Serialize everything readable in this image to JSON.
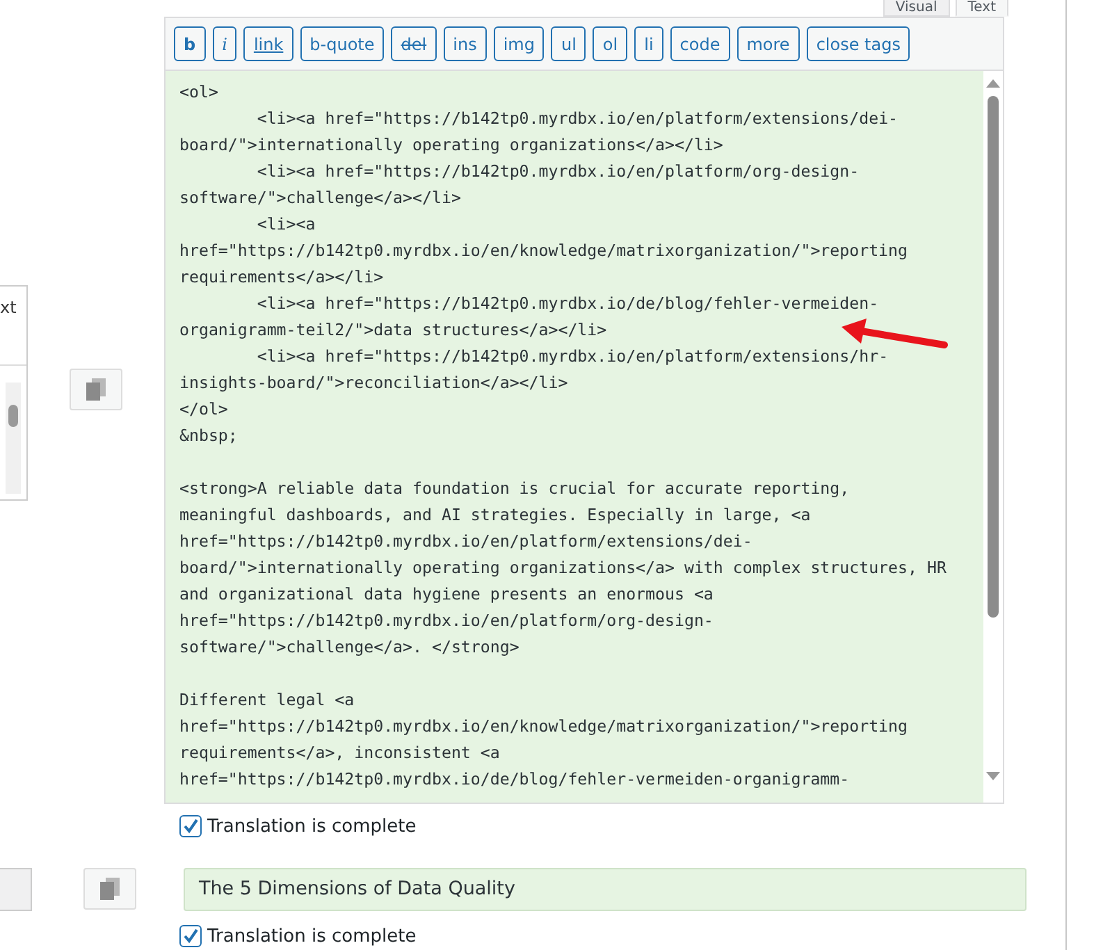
{
  "editor_tabs": [
    {
      "label": "Visual",
      "selected": false
    },
    {
      "label": "Text",
      "selected": true
    }
  ],
  "toolbar": [
    {
      "label": "b",
      "kind": "bold"
    },
    {
      "label": "i",
      "kind": "italic"
    },
    {
      "label": "link",
      "kind": "link"
    },
    {
      "label": "b-quote",
      "kind": "plain"
    },
    {
      "label": "del",
      "kind": "strike"
    },
    {
      "label": "ins",
      "kind": "plain"
    },
    {
      "label": "img",
      "kind": "plain"
    },
    {
      "label": "ul",
      "kind": "plain"
    },
    {
      "label": "ol",
      "kind": "plain"
    },
    {
      "label": "li",
      "kind": "plain"
    },
    {
      "label": "code",
      "kind": "plain"
    },
    {
      "label": "more",
      "kind": "plain"
    },
    {
      "label": "close tags",
      "kind": "plain"
    }
  ],
  "code_blocks": [
    [
      "<ol>",
      "\t<li><a href=\"https://b142tp0.myrdbx.io/en/platform/extensions/dei-",
      "board/\">internationally operating organizations</a></li>",
      "\t<li><a href=\"https://b142tp0.myrdbx.io/en/platform/org-design-",
      "software/\">challenge</a></li>",
      "\t<li><a",
      "href=\"https://b142tp0.myrdbx.io/en/knowledge/matrixorganization/\">reporting",
      "requirements</a></li>",
      "\t<li><a href=\"https://b142tp0.myrdbx.io/de/blog/fehler-vermeiden-",
      "organigramm-teil2/\">data structures</a></li>",
      "\t<li><a href=\"https://b142tp0.myrdbx.io/en/platform/extensions/hr-",
      "insights-board/\">reconciliation</a></li>",
      "</ol>",
      "&nbsp;"
    ],
    [
      "<strong>A reliable data foundation is crucial for accurate reporting,",
      "meaningful dashboards, and AI strategies. Especially in large, <a",
      "href=\"https://b142tp0.myrdbx.io/en/platform/extensions/dei-",
      "board/\">internationally operating organizations</a> with complex structures, HR",
      "and organizational data hygiene presents an enormous <a",
      "href=\"https://b142tp0.myrdbx.io/en/platform/org-design-",
      "software/\">challenge</a>. </strong>"
    ],
    [
      "Different legal <a",
      "href=\"https://b142tp0.myrdbx.io/en/knowledge/matrixorganization/\">reporting",
      "requirements</a>, inconsistent <a",
      "href=\"https://b142tp0.myrdbx.io/de/blog/fehler-vermeiden-organigramm-"
    ]
  ],
  "side_fragment": {
    "label": "xt"
  },
  "translation_1": {
    "label": "Translation is complete",
    "checked": true
  },
  "title_field": {
    "value": "The 5 Dimensions of Data Quality"
  },
  "translation_2": {
    "label": "Translation is complete",
    "checked": true
  }
}
